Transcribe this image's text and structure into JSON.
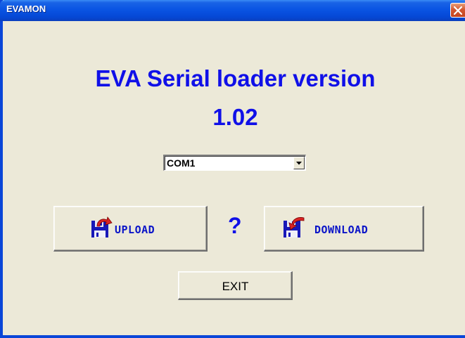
{
  "window": {
    "title": "EVAMON",
    "close_icon": "close-icon"
  },
  "heading": {
    "line1": "EVA Serial loader version",
    "line2": "1.02"
  },
  "port_select": {
    "value": "COM1",
    "arrow_icon": "chevron-down-icon"
  },
  "buttons": {
    "upload": {
      "label": "UPLOAD",
      "icon": "floppy-upload-icon"
    },
    "download": {
      "label": "DOWNLOAD",
      "icon": "floppy-download-icon"
    },
    "exit": {
      "label": "EXIT"
    }
  },
  "help": {
    "label": "?"
  },
  "colors": {
    "heading": "#1010e8",
    "button_text": "#0a14c8",
    "titlebar": "#0a54e3",
    "background": "#ece9d8",
    "close_button": "#d4572f"
  }
}
